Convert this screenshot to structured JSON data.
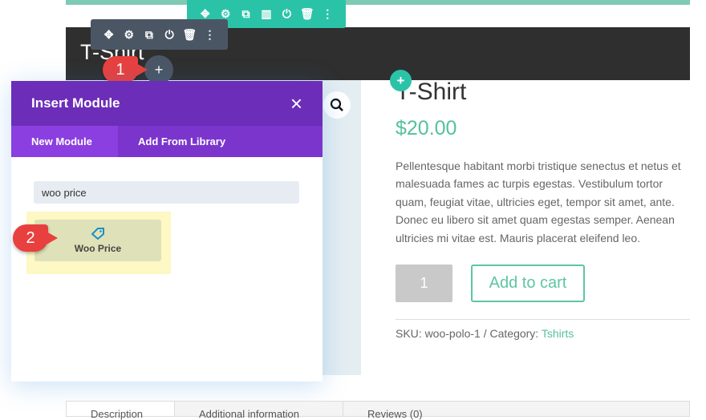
{
  "header": {
    "title": "T-Shirt"
  },
  "row_toolbar": {
    "icons": [
      "move-icon",
      "gear-icon",
      "duplicate-icon",
      "columns-icon",
      "power-icon",
      "trash-icon",
      "more-icon"
    ]
  },
  "module_toolbar": {
    "icons": [
      "move-icon",
      "gear-icon",
      "duplicate-icon",
      "power-icon",
      "trash-icon",
      "more-icon"
    ]
  },
  "annotations": [
    "1",
    "2"
  ],
  "modal": {
    "title": "Insert Module",
    "close": "×",
    "tabs": [
      {
        "label": "New Module"
      },
      {
        "label": "Add From Library"
      }
    ],
    "search_value": "woo price",
    "result": {
      "label": "Woo Price",
      "icon": "tag-icon"
    }
  },
  "product": {
    "title": "T-Shirt",
    "price": "$20.00",
    "description": "Pellentesque habitant morbi tristique senectus et netus et malesuada fames ac turpis egestas. Vestibulum tortor quam, feugiat vitae, ultricies eget, tempor sit amet, ante. Donec eu libero sit amet quam egestas semper. Aenean ultricies mi vitae est. Mauris placerat eleifend leo.",
    "qty": "1",
    "add_to_cart": "Add to cart",
    "sku_text": "SKU: woo-polo-1 / Category: ",
    "category": "Tshirts"
  },
  "bottom_tabs": [
    "Description",
    "Additional information",
    "Reviews (0)"
  ],
  "colors": {
    "purple": "#6c2db8",
    "teal": "#2bc3a8",
    "price": "#55c0a0",
    "badge": "#e8403f"
  }
}
